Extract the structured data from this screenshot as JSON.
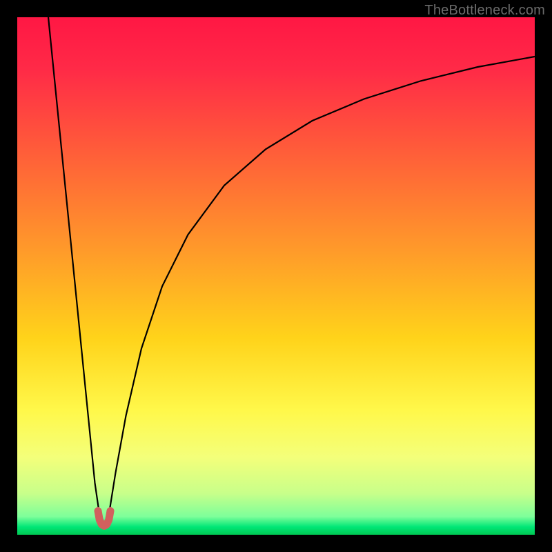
{
  "watermark": "TheBottleneck.com",
  "chart_data": {
    "type": "line",
    "title": "",
    "xlabel": "",
    "ylabel": "",
    "xlim": [
      0,
      100
    ],
    "ylim": [
      0,
      100
    ],
    "grid": false,
    "legend": false,
    "gradient_stops": [
      {
        "offset": 0.0,
        "color": "#ff1744"
      },
      {
        "offset": 0.1,
        "color": "#ff2a47"
      },
      {
        "offset": 0.25,
        "color": "#ff5a3a"
      },
      {
        "offset": 0.45,
        "color": "#ff9a2a"
      },
      {
        "offset": 0.62,
        "color": "#ffd31a"
      },
      {
        "offset": 0.76,
        "color": "#fff84a"
      },
      {
        "offset": 0.85,
        "color": "#f4ff7a"
      },
      {
        "offset": 0.92,
        "color": "#c8ff8a"
      },
      {
        "offset": 0.965,
        "color": "#7dff9a"
      },
      {
        "offset": 0.985,
        "color": "#00e676"
      },
      {
        "offset": 1.0,
        "color": "#00c853"
      }
    ],
    "series": [
      {
        "name": "left-branch",
        "stroke": "#000000",
        "stroke_width": 2.2,
        "x": [
          6.0,
          7.0,
          8.0,
          9.0,
          10.0,
          11.0,
          12.0,
          13.0,
          14.0,
          15.0,
          15.8
        ],
        "y": [
          100.0,
          90.0,
          80.0,
          70.0,
          60.0,
          50.0,
          40.0,
          30.0,
          20.0,
          10.0,
          4.5
        ]
      },
      {
        "name": "right-branch",
        "stroke": "#000000",
        "stroke_width": 2.2,
        "x": [
          17.8,
          19.0,
          21.0,
          24.0,
          28.0,
          33.0,
          40.0,
          48.0,
          57.0,
          67.0,
          78.0,
          89.0,
          100.0
        ],
        "y": [
          4.5,
          12.0,
          23.0,
          36.0,
          48.0,
          58.0,
          67.5,
          74.5,
          80.0,
          84.2,
          87.7,
          90.4,
          92.4
        ]
      },
      {
        "name": "valley-marker",
        "stroke": "#d1605e",
        "stroke_width": 11,
        "linecap": "round",
        "x": [
          15.6,
          15.9,
          16.3,
          16.8,
          17.3,
          17.7,
          18.0
        ],
        "y": [
          4.6,
          2.9,
          2.0,
          1.7,
          2.0,
          2.9,
          4.6
        ]
      }
    ]
  }
}
